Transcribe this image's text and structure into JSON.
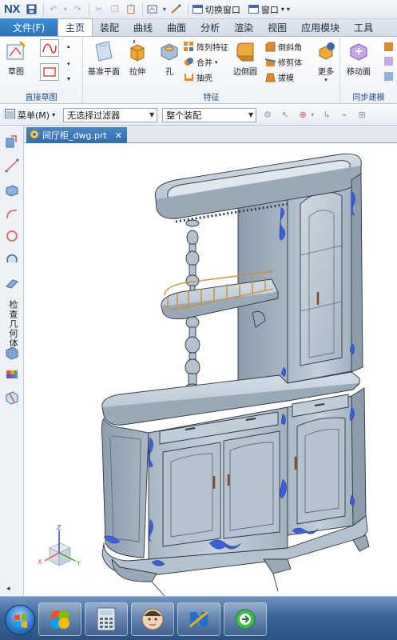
{
  "app": {
    "logo": "NX",
    "quick_access": {
      "switch_window": "切换窗口",
      "window_menu": "窗口",
      "more": "▾"
    }
  },
  "ribbon": {
    "tabs": [
      "文件(F)",
      "主页",
      "装配",
      "曲线",
      "曲面",
      "分析",
      "渲染",
      "视图",
      "应用模块",
      "工具"
    ],
    "active_tab": "主页",
    "groups": {
      "sketch": {
        "label": "直接草图",
        "sketch_button": "草图"
      },
      "feature": {
        "label": "特征",
        "datum_plane": "基准平面",
        "extrude": "拉伸",
        "hole": "孔",
        "pattern_feature": "阵列特征",
        "unite": "合并",
        "shell": "抽壳",
        "edge_blend": "边倒圆",
        "chamfer": "倒斜角",
        "trim_body": "修剪体",
        "draft": "拔模",
        "more": "更多"
      },
      "sync": {
        "label": "同步建模",
        "move_face": "移动面"
      }
    }
  },
  "selection_bar": {
    "menu_label": "菜单(M)",
    "filter_value": "无选择过滤器",
    "scope_value": "整个装配"
  },
  "resource_bar": {
    "vertical_text": "检查几何体",
    "bottom_marker": "◂"
  },
  "document": {
    "tab_name": "间厅柜_dwg.prt",
    "close_glyph": "✕"
  },
  "triad": {
    "x": "X",
    "y": "Y",
    "z": "Z"
  },
  "colors": {
    "model_body": "#b9c6d2",
    "model_shadow": "#8b9aab",
    "model_edge": "#2d3640",
    "ornament": "#3a5fd8",
    "ribbon_accent": "#2a72b8",
    "rail": "#c9913c"
  },
  "taskbar": {
    "apps": [
      "windows-start",
      "office-app",
      "calculator-app",
      "user-avatar-app",
      "nx-app",
      "browser-app"
    ]
  }
}
